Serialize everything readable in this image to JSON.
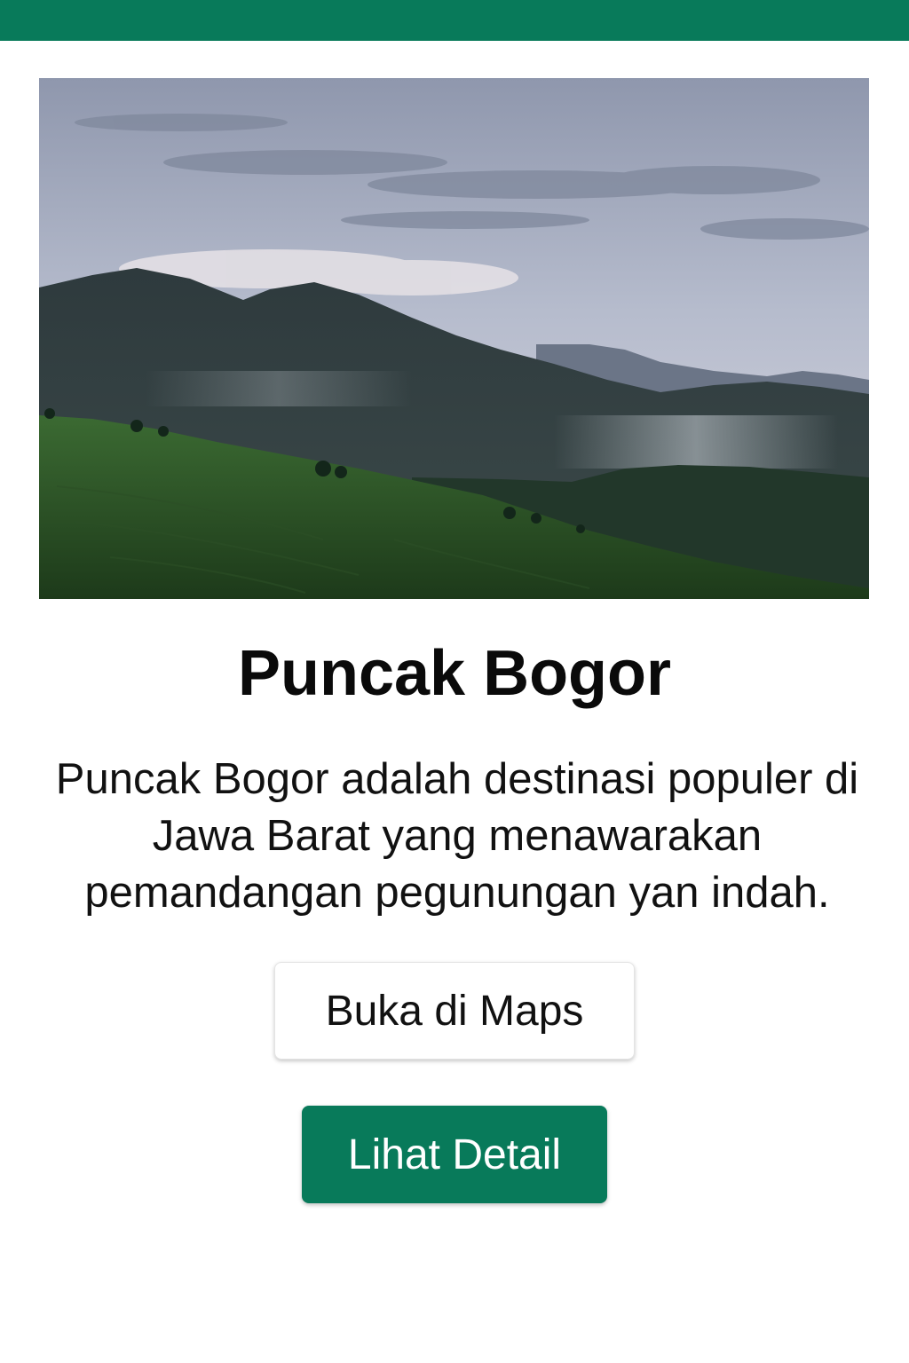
{
  "app": {
    "header_color": "#087a5a"
  },
  "destination": {
    "image_alt": "mountain-landscape-photo",
    "name": "Puncak Bogor",
    "description": "Puncak Bogor adalah destinasi populer di Jawa Barat yang menawarakan pemandangan pegunungan yan indah."
  },
  "actions": {
    "maps_label": "Buka di Maps",
    "detail_label": "Lihat Detail",
    "primary_color": "#087a5a"
  }
}
